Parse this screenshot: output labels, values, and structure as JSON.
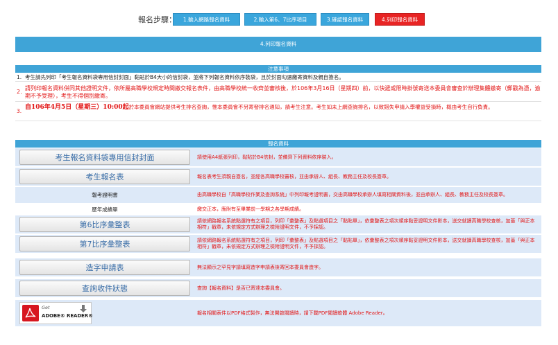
{
  "steps": {
    "label": "報名步驟：",
    "items": [
      {
        "label": "1.輸入網路報名資料",
        "active": false
      },
      {
        "label": "2.輸入第6、7比序項目",
        "active": false
      },
      {
        "label": "3.確認報名資料",
        "active": false
      },
      {
        "label": "4.列印報名資料",
        "active": true
      }
    ]
  },
  "main_title": "4.列印報名資料",
  "notes": {
    "title": "注意事項",
    "items": [
      {
        "num": "1.",
        "text": "考生請先列印「考生報名資料袋專用信封封面」黏貼於B4大小的信封袋，並將下列報名資料依序裝袋，且於封面勾選繳寄資料及親自簽名。"
      },
      {
        "num": "2.",
        "text": "請列印報名資料併同其他證明文件，依所屬高職學校規定時間繳交報名表件，由高職學校統一收齊並審核後，於106年3月16日（星期四）前，以快遞或限時掛號寄送本委員會審查於辦理集體繳寄（郵戳為憑，逾期不予受理），考生不得個別繳寄。"
      },
      {
        "num": "3.",
        "big": "自106年4月5日（星期三）10:00起",
        "text": "於本委員會網站提供考生排名查詢，惟本委員會不另寄發排名通知，請考生注意。考生如未上網查詢排名，以致錯失申請入學權益受損時，概由考生自行負責。"
      }
    ]
  },
  "form": {
    "title": "報名資料",
    "rows": [
      {
        "label": "考生報名資料袋專用信封封面",
        "desc": "請使用A4紙張列印，黏貼於B4信封，並備齊下列資料依序裝入。"
      },
      {
        "label": "考生報名表",
        "desc": "報名表考生須親自簽名，並經各高職學校審核，並由承辦人、組長、教務主任及校長簽章。"
      },
      {
        "label": "報考證明書",
        "desc": "由高職學校自「高職學校作業及查詢系統」中列印報考證明書，交由高職學校承辦人填寫相關資料後，並由承辦人、組長、教務主任及校長簽章。"
      },
      {
        "label": "歷年成績單",
        "desc": "繳交正本，應附有至畢業前一學期之各學期成績。"
      },
      {
        "label": "第6比序彙整表",
        "desc": "請依網路報名系統點選符有之項目，列印「彙整表」及點選項目之「黏貼單」，依彙整表之項次順序黏妥證明文件影本，送交就讀高職學校查核，加蓋「與正本相符」戳章，未依規定方式辦理之檢附證明文件，不予採認。"
      },
      {
        "label": "第7比序彙整表",
        "desc": "請依網路報名系統點選符有之項目，列印「彙整表」及點選項目之「黏貼單」，依彙整表之項次順序黏妥證明文件影本，送交就讀高職學校查核，加蓋「與正本相符」戳章，未依規定方式辦理之檢附證明文件，不予採認。"
      },
      {
        "label": "造字申請表",
        "desc": "無法顯示之罕見字請填寫造字申請表後寄回本委員會造字。"
      },
      {
        "label": "查詢收件狀態",
        "desc": "查詢【報名資料】是否已寄達本委員會。"
      },
      {
        "label": "",
        "desc": "報名相關表件以PDF格式製作，無法開啟閱讀時，請下載PDF閱讀軟體 Adobe Reader。"
      }
    ]
  },
  "adobe": {
    "get": "Get",
    "reader": "ADOBE® READER®"
  },
  "colors": {
    "step": "#3aa6dc",
    "step_active": "#e82424",
    "bar": "#3fa4d7",
    "row": "#dde9f8",
    "note_red": "#e21515",
    "button_text": "#3a6ea8"
  }
}
